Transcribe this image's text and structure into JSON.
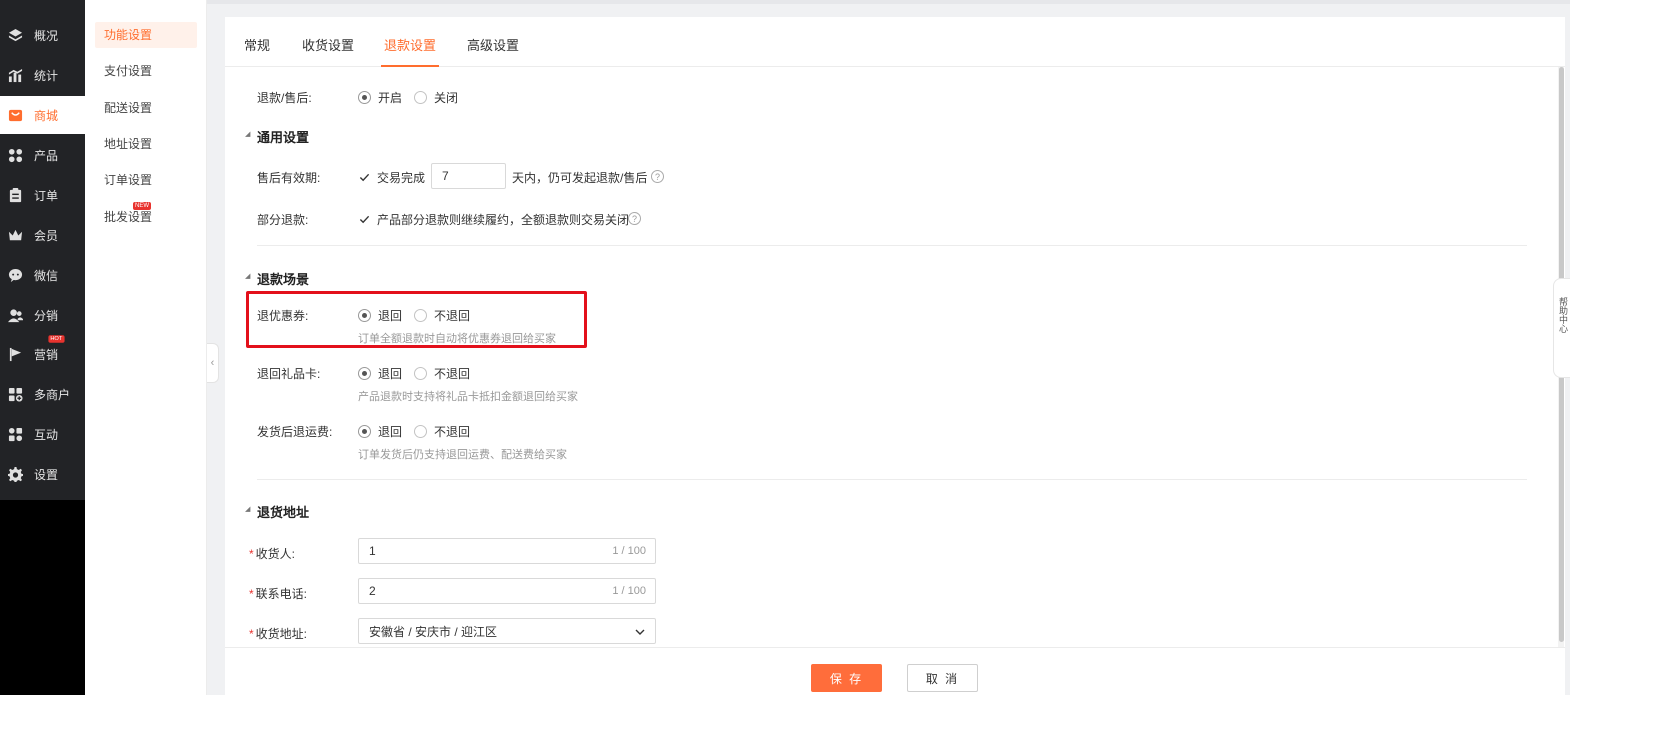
{
  "main_nav": {
    "items": [
      {
        "label": "概况",
        "icon": "layers-icon"
      },
      {
        "label": "统计",
        "icon": "chart-icon"
      },
      {
        "label": "商城",
        "icon": "shop-icon",
        "active": true
      },
      {
        "label": "产品",
        "icon": "grid-icon"
      },
      {
        "label": "订单",
        "icon": "order-icon"
      },
      {
        "label": "会员",
        "icon": "crown-icon"
      },
      {
        "label": "微信",
        "icon": "wechat-icon"
      },
      {
        "label": "分销",
        "icon": "users-icon"
      },
      {
        "label": "营销",
        "icon": "flag-icon",
        "badge": "HOT"
      },
      {
        "label": "多商户",
        "icon": "store-plus-icon"
      },
      {
        "label": "互动",
        "icon": "interact-icon"
      },
      {
        "label": "设置",
        "icon": "gear-icon"
      }
    ]
  },
  "sub_nav": {
    "items": [
      {
        "label": "功能设置",
        "active": true
      },
      {
        "label": "支付设置"
      },
      {
        "label": "配送设置"
      },
      {
        "label": "地址设置"
      },
      {
        "label": "订单设置"
      },
      {
        "label": "批发设置",
        "badge": "NEW"
      }
    ]
  },
  "tabs": [
    {
      "label": "常规"
    },
    {
      "label": "收货设置"
    },
    {
      "label": "退款设置",
      "active": true
    },
    {
      "label": "高级设置"
    }
  ],
  "form": {
    "refund_after_sale": {
      "label": "退款/售后:",
      "options": [
        "开启",
        "关闭"
      ],
      "selected": "开启"
    },
    "general_section": {
      "title": "通用设置"
    },
    "validity": {
      "label": "售后有效期:",
      "checkbox_label": "交易完成",
      "checked": true,
      "days_value": "7",
      "suffix": "天内，仍可发起退款/售后"
    },
    "partial_refund": {
      "label": "部分退款:",
      "checkbox_label": "产品部分退款则继续履约，全额退款则交易关闭",
      "checked": true
    },
    "scene_section": {
      "title": "退款场景"
    },
    "coupon": {
      "label": "退优惠券:",
      "options": [
        "退回",
        "不退回"
      ],
      "selected": "退回",
      "hint": "订单全额退款时自动将优惠券退回给买家"
    },
    "gift_card": {
      "label": "退回礼品卡:",
      "options": [
        "退回",
        "不退回"
      ],
      "selected": "退回",
      "hint": "产品退款时支持将礼品卡抵扣金额退回给买家"
    },
    "shipping_fee": {
      "label": "发货后退运费:",
      "options": [
        "退回",
        "不退回"
      ],
      "selected": "退回",
      "hint": "订单发货后仍支持退回运费、配送费给买家"
    },
    "address_section": {
      "title": "退货地址"
    },
    "receiver": {
      "label": "收货人:",
      "value": "1",
      "counter": "1 / 100"
    },
    "phone": {
      "label": "联系电话:",
      "value": "2",
      "counter": "1 / 100"
    },
    "address": {
      "label": "收货地址:",
      "value": "安徽省 / 安庆市 / 迎江区"
    }
  },
  "actions": {
    "save": "保 存",
    "cancel": "取 消"
  },
  "help_tab": {
    "label": "帮助中心"
  },
  "colors": {
    "accent": "#ff6d2e",
    "highlight": "#e3101b",
    "nav_bg": "#222326"
  }
}
